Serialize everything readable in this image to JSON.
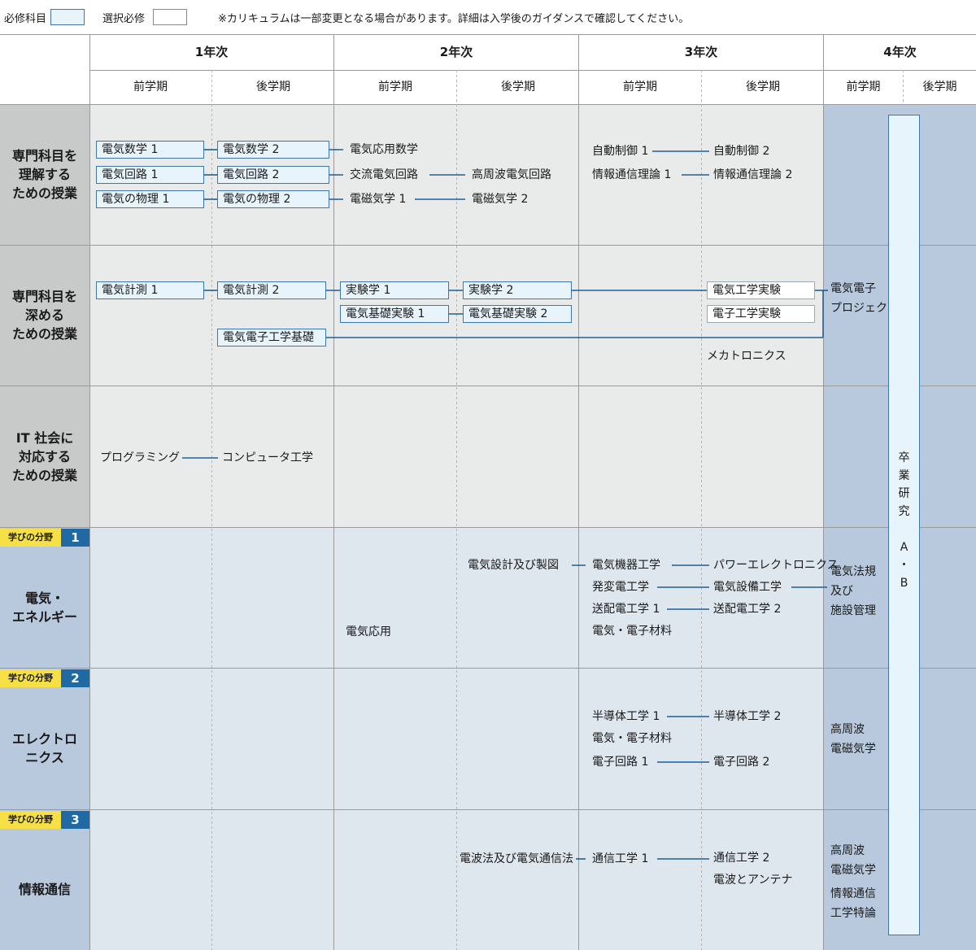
{
  "legend": {
    "required_label": "必修科目",
    "elective_label": "選択必修",
    "notice": "※カリキュラムは一部変更となる場合があります。詳細は入学後のガイダンスで確認してください。"
  },
  "years": [
    "1年次",
    "2年次",
    "3年次",
    "4年次"
  ],
  "terms": [
    "前学期",
    "後学期",
    "前学期",
    "後学期",
    "前学期",
    "後学期",
    "前学期",
    "後学期"
  ],
  "rows": {
    "r1": "専門科目を\n理解する\nための授業",
    "r2": "専門科目を\n深める\nための授業",
    "r3": "IT 社会に\n対応する\nための授業",
    "r4": "電気・\nエネルギー",
    "r5": "エレクトロ\nニクス",
    "r6": "情報通信"
  },
  "field_tag": {
    "label": "学びの分野",
    "n1": "1",
    "n2": "2",
    "n3": "3"
  },
  "courses": {
    "c_math1": "電気数学 1",
    "c_math2": "電気数学 2",
    "c_appmath": "電気応用数学",
    "c_circ1": "電気回路 1",
    "c_circ2": "電気回路 2",
    "c_accirc": "交流電気回路",
    "c_hfcirc": "高周波電気回路",
    "c_phys1": "電気の物理 1",
    "c_phys2": "電気の物理 2",
    "c_em1": "電磁気学 1",
    "c_em2": "電磁気学 2",
    "c_ctrl1": "自動制御 1",
    "c_ctrl2": "自動制御 2",
    "c_info1": "情報通信理論 1",
    "c_info2": "情報通信理論 2",
    "c_meas1": "電気計測 1",
    "c_meas2": "電気計測 2",
    "c_exp1": "実験学 1",
    "c_exp2": "実験学 2",
    "c_bexp1": "電気基礎実験 1",
    "c_bexp2": "電気基礎実験 2",
    "c_eeexp": "電気工学実験",
    "c_elexp": "電子工学実験",
    "c_proj": "電気電子\nプロジェクト",
    "c_eebasic": "電気電子工学基礎",
    "c_mecha": "メカトロニクス",
    "c_prog": "プログラミング",
    "c_comp": "コンピュータ工学",
    "c_design": "電気設計及び製図",
    "c_machine": "電気機器工学",
    "c_power": "パワーエレクトロニクス",
    "c_gen": "発変電工学",
    "c_facility": "電気設備工学",
    "c_trans1": "送配電工学 1",
    "c_trans2": "送配電工学 2",
    "c_mat1": "電気・電子材料",
    "c_law": "電気法規\n及び\n施設管理",
    "c_app": "電気応用",
    "c_semi1": "半導体工学 1",
    "c_semi2": "半導体工学 2",
    "c_mat2": "電気・電子材料",
    "c_ecirc1": "電子回路 1",
    "c_ecirc2": "電子回路 2",
    "c_hfem1": "高周波\n電磁気学",
    "c_radiolaw": "電波法及び電気通信法",
    "c_comm1": "通信工学 1",
    "c_comm2": "通信工学 2",
    "c_antenna": "電波とアンテナ",
    "c_hfem2": "高周波\n電磁気学",
    "c_infospec": "情報通信\n工学特論"
  },
  "thesis": "卒\n業\n研\n究\n\nA\n・\nB",
  "colors": {
    "core_bg": "#e9ebea",
    "field_bg": "#dee6ee",
    "label_gray": "#c8c9c9",
    "label_blue": "#b9c9dd",
    "y4_bg": "#b9c9dd",
    "required_fill": "#e8f4fb",
    "line": "#1f5f94",
    "tag_yellow": "#f7e046",
    "tag_blue": "#1f6aa5"
  }
}
